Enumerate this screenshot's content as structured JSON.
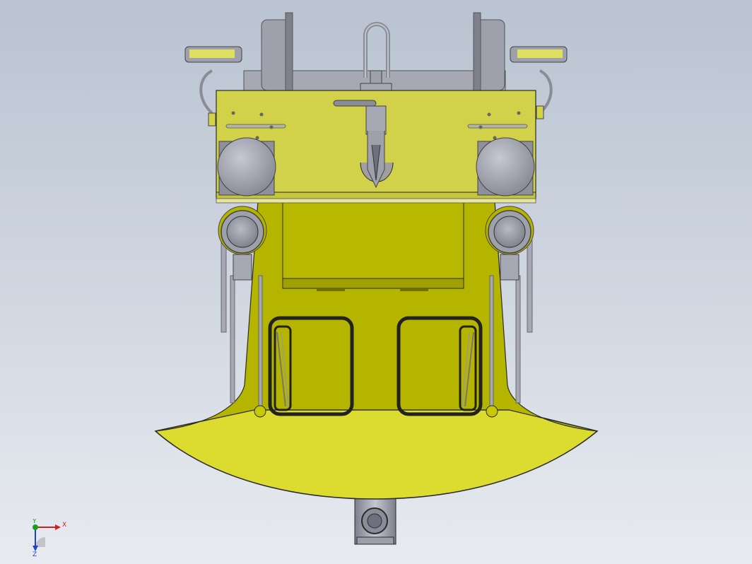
{
  "viewport": {
    "background_top": "#b9c3d1",
    "background_bottom": "#e8ebf0"
  },
  "model": {
    "body_color": "#b5b500",
    "plate_color": "#d2d24a",
    "bucket_color": "#dcdc30",
    "metal_color": "#a6a8b4",
    "outline_color": "#2b2b2b"
  },
  "triad": {
    "x_label": "X",
    "y_label": "Y",
    "z_label": "Z",
    "x_color": "#d42020",
    "y_color": "#18a018",
    "z_color": "#2040c8"
  }
}
